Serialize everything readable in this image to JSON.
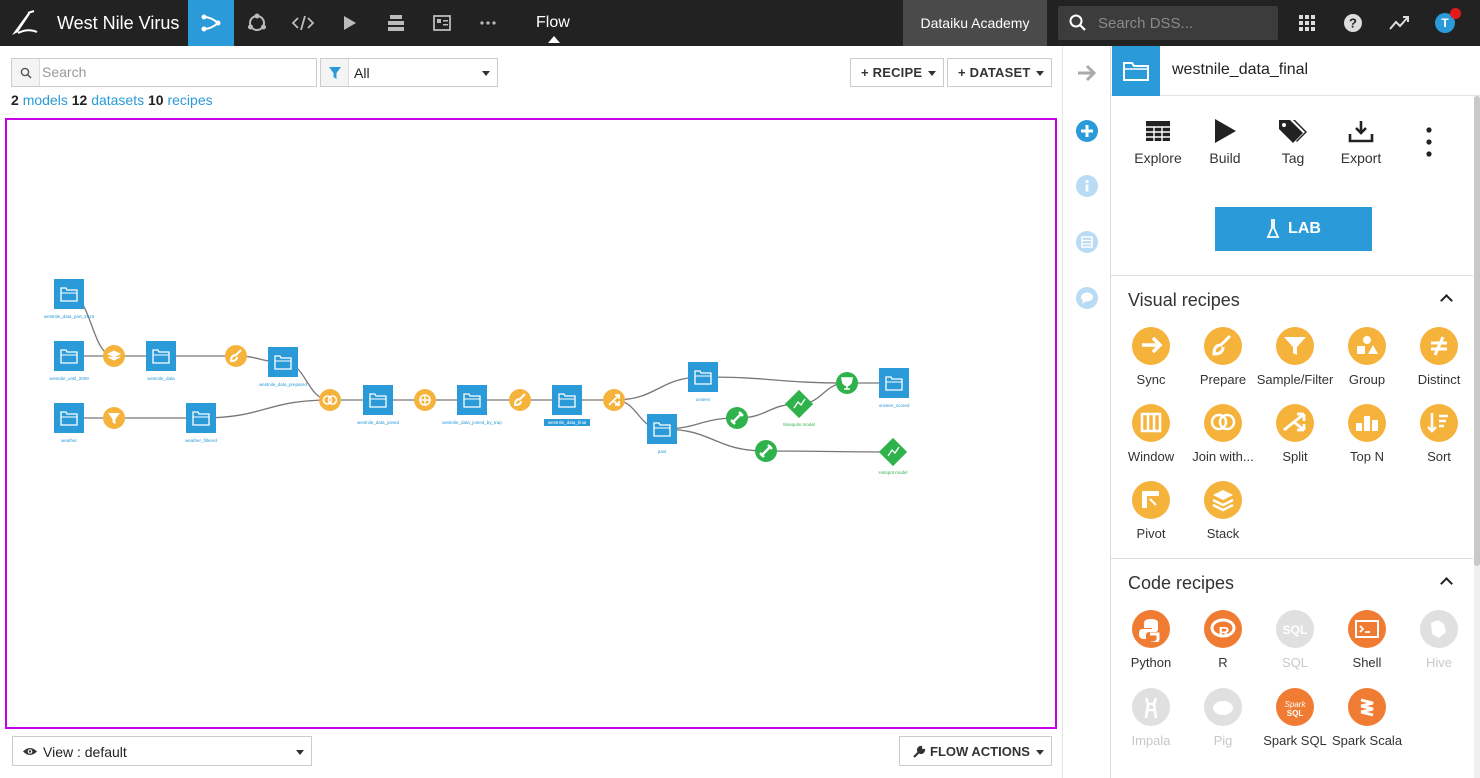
{
  "app": {
    "project_title": "West Nile Virus",
    "current_view": "Flow",
    "academy_label": "Dataiku Academy",
    "search_placeholder": "Search DSS...",
    "user_initial": "T"
  },
  "toolbar": {
    "search_placeholder": "Search",
    "filter_value": "All",
    "recipe_button": "+ RECIPE",
    "dataset_button": "+ DATASET"
  },
  "counts": {
    "models_num": "2",
    "models_label": "models",
    "datasets_num": "12",
    "datasets_label": "datasets",
    "recipes_num": "10",
    "recipes_label": "recipes"
  },
  "flow": {
    "nodes": [
      {
        "id": "d1",
        "kind": "dataset",
        "label": "westnile_data_part_2015"
      },
      {
        "id": "d2",
        "kind": "dataset",
        "label": "westnile_until_2009"
      },
      {
        "id": "d3",
        "kind": "dataset",
        "label": "weather"
      },
      {
        "id": "r_stack",
        "kind": "recipe",
        "icon": "stack"
      },
      {
        "id": "r_filter",
        "kind": "recipe",
        "icon": "filter"
      },
      {
        "id": "d4",
        "kind": "dataset",
        "label": "westnile_data"
      },
      {
        "id": "d5",
        "kind": "dataset",
        "label": "weather_filtered"
      },
      {
        "id": "r_prep1",
        "kind": "recipe",
        "icon": "prepare"
      },
      {
        "id": "d6",
        "kind": "dataset",
        "label": "westnile_data_prepared"
      },
      {
        "id": "r_join",
        "kind": "recipe",
        "icon": "join"
      },
      {
        "id": "d7",
        "kind": "dataset",
        "label": "westnile_data_joined"
      },
      {
        "id": "r_window",
        "kind": "recipe",
        "icon": "window"
      },
      {
        "id": "d8",
        "kind": "dataset",
        "label": "westnile_data_joined_by_trap"
      },
      {
        "id": "r_prep2",
        "kind": "recipe",
        "icon": "prepare"
      },
      {
        "id": "d9",
        "kind": "dataset",
        "label": "westnile_data_final",
        "selected": true
      },
      {
        "id": "r_split",
        "kind": "recipe",
        "icon": "split"
      },
      {
        "id": "d10",
        "kind": "dataset",
        "label": "unseen"
      },
      {
        "id": "d11",
        "kind": "dataset",
        "label": "past"
      },
      {
        "id": "r_train1",
        "kind": "ml",
        "icon": "train"
      },
      {
        "id": "r_train2",
        "kind": "ml",
        "icon": "train"
      },
      {
        "id": "m1",
        "kind": "model",
        "label": "Mosquito model"
      },
      {
        "id": "m2",
        "kind": "model",
        "label": "Hotspot model"
      },
      {
        "id": "r_score",
        "kind": "ml",
        "icon": "score"
      },
      {
        "id": "d12",
        "kind": "dataset",
        "label": "unseen_scored"
      }
    ]
  },
  "bottom": {
    "view_label": "View : default",
    "flow_actions": "FLOW ACTIONS"
  },
  "panel": {
    "title": "westnile_data_final",
    "actions": [
      {
        "label": "Explore",
        "icon": "table-icon"
      },
      {
        "label": "Build",
        "icon": "play-icon"
      },
      {
        "label": "Tag",
        "icon": "tag-icon"
      },
      {
        "label": "Export",
        "icon": "export-icon"
      }
    ],
    "lab_label": "LAB",
    "visual_header": "Visual recipes",
    "visual_recipes": [
      {
        "label": "Sync",
        "icon": "sync-icon"
      },
      {
        "label": "Prepare",
        "icon": "brush-icon"
      },
      {
        "label": "Sample/Filter",
        "icon": "filter-icon"
      },
      {
        "label": "Group",
        "icon": "group-icon"
      },
      {
        "label": "Distinct",
        "icon": "distinct-icon"
      },
      {
        "label": "Window",
        "icon": "window-icon"
      },
      {
        "label": "Join with...",
        "icon": "join-icon"
      },
      {
        "label": "Split",
        "icon": "split-icon"
      },
      {
        "label": "Top N",
        "icon": "topn-icon"
      },
      {
        "label": "Sort",
        "icon": "sort-icon"
      },
      {
        "label": "Pivot",
        "icon": "pivot-icon"
      },
      {
        "label": "Stack",
        "icon": "stack-icon"
      }
    ],
    "code_header": "Code recipes",
    "code_recipes": [
      {
        "label": "Python",
        "icon": "python-icon",
        "enabled": true
      },
      {
        "label": "R",
        "icon": "r-icon",
        "enabled": true
      },
      {
        "label": "SQL",
        "icon": "sql-icon",
        "enabled": false
      },
      {
        "label": "Shell",
        "icon": "shell-icon",
        "enabled": true
      },
      {
        "label": "Hive",
        "icon": "hive-icon",
        "enabled": false
      },
      {
        "label": "Impala",
        "icon": "impala-icon",
        "enabled": false
      },
      {
        "label": "Pig",
        "icon": "pig-icon",
        "enabled": false
      },
      {
        "label": "Spark SQL",
        "icon": "spark-sql-icon",
        "enabled": true
      },
      {
        "label": "Spark Scala",
        "icon": "spark-scala-icon",
        "enabled": true
      }
    ]
  },
  "colors": {
    "accent": "#2a9ad8",
    "recipe_orange": "#f6b33c",
    "code_orange": "#f07c34",
    "ml_green": "#2fb24c",
    "selection": "#c400e6",
    "topbar": "#222222"
  }
}
